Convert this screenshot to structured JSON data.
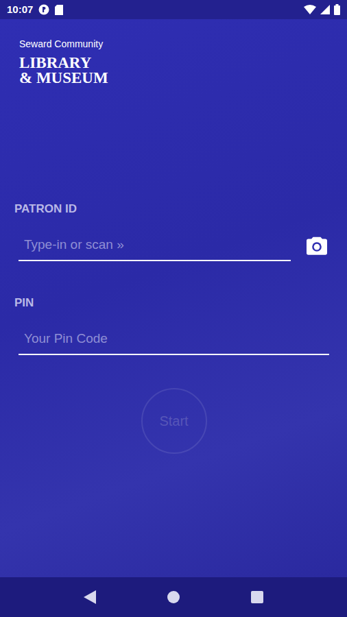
{
  "status_bar": {
    "time": "10:07"
  },
  "logo": {
    "lines": [
      "Seward Community",
      "LIBRARY",
      "& MUSEUM"
    ]
  },
  "fields": [
    {
      "label": "PATRON ID",
      "placeholder": "Type-in or scan »",
      "kind": "scan"
    },
    {
      "label": "PIN",
      "placeholder": "Your Pin Code",
      "kind": "plain"
    }
  ],
  "start_button": {
    "label": "Start",
    "disabled": true
  }
}
